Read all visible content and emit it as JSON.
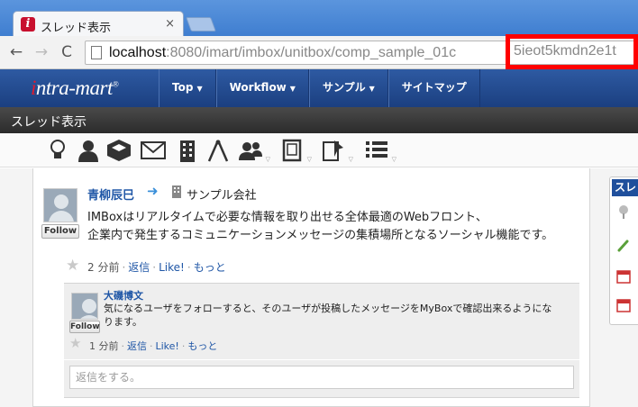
{
  "browser": {
    "tab_title": "スレッド表示",
    "tab_close": "×",
    "favicon_letter": "i",
    "url_host": "localhost",
    "url_rest": ":8080/imart/imbox/unitbox/comp_sample_01c",
    "url_highlight": "5ieot5kmdn2e1t",
    "back_icon": "←",
    "forward_icon": "→",
    "reload_icon": "C"
  },
  "app": {
    "logo_prefix": "i",
    "logo_rest": "ntra-mart",
    "logo_reg": "®",
    "menu": [
      {
        "label": "Top"
      },
      {
        "label": "Workflow"
      },
      {
        "label": "サンプル"
      },
      {
        "label": "サイトマップ"
      }
    ],
    "caret": "▼",
    "page_title": "スレッド表示"
  },
  "iconbar": {
    "icons": [
      "lightbulb-icon",
      "user-icon",
      "cube-icon",
      "mail-icon",
      "building-icon",
      "compass-icon",
      "users-icon",
      "document-icon",
      "pin-icon",
      "list-icon"
    ],
    "dd": "▽"
  },
  "thread": {
    "author": "青柳辰巳",
    "arrow": "➜",
    "group": "サンプル会社",
    "message_line1": "IMBoxはリアルタイムで必要な情報を取り出せる全体最適のWebフロント、",
    "message_line2": "企業内で発生するコミュニケーションメッセージの集積場所となるソーシャル機能です。",
    "follow_label": "Follow",
    "time": "2 分前",
    "reply_link": "返信",
    "like_link": "Like!",
    "more_link": "もっと",
    "sep": "·"
  },
  "reply": {
    "author": "大磯博文",
    "message": "気になるユーザをフォローすると、そのユーザが投稿したメッセージをMyBoxで確認出来るようになります。",
    "follow_label": "Follow",
    "time": "1 分前",
    "reply_link": "返信",
    "like_link": "Like!",
    "more_link": "もっと"
  },
  "reply_box": {
    "placeholder": "返信をする。"
  },
  "side_panel": {
    "header": "スレ"
  }
}
